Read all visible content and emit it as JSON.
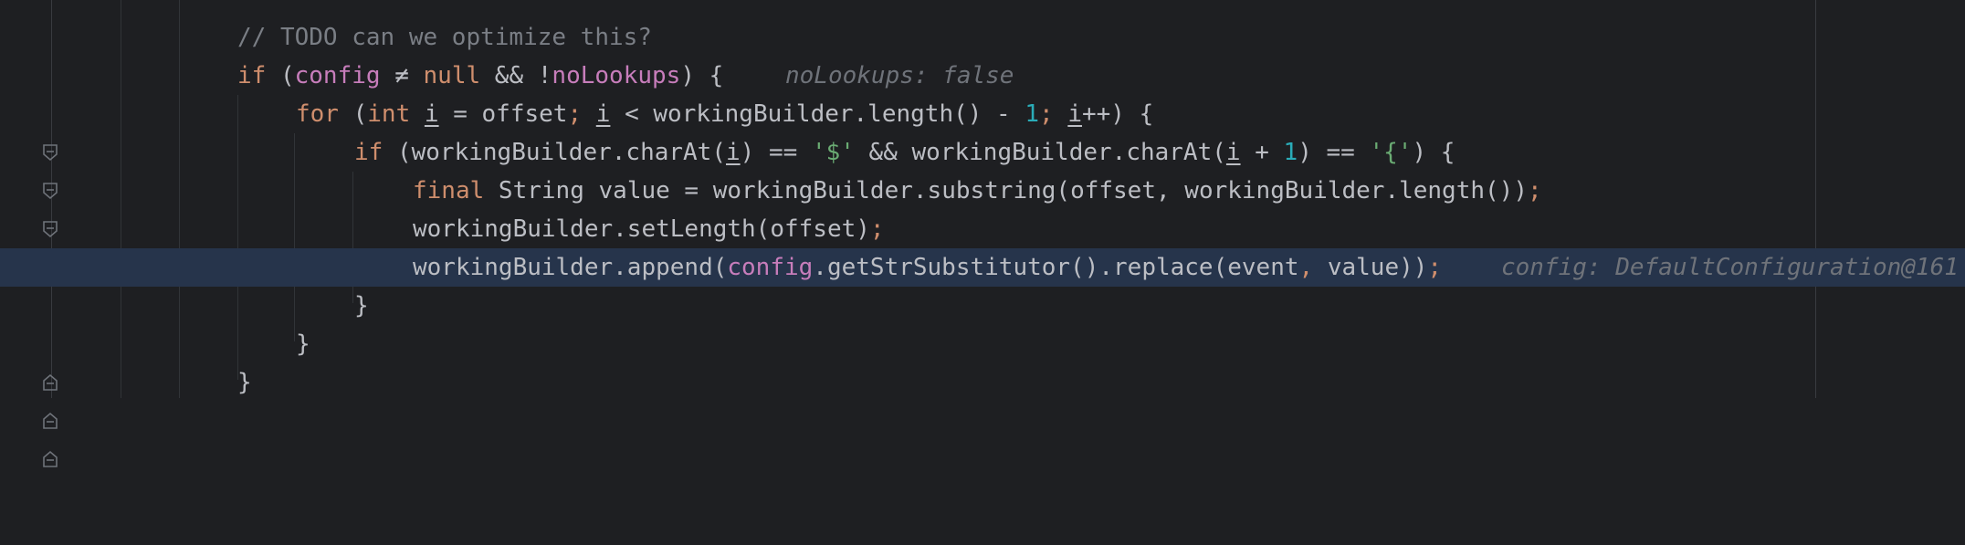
{
  "code": {
    "comment": "// TODO can we optimize this?",
    "l2": {
      "if_kw": "if",
      "open": " (",
      "config": "config",
      "neq": " ≠ ",
      "null_kw": "null",
      "and": " && !",
      "noLookups": "noLookups",
      "close": ") {",
      "hint": "noLookups: false"
    },
    "l3": {
      "for_kw": "for",
      "open": " (",
      "int_kw": "int",
      "sp": " ",
      "i1": "i",
      "assign": " = offset",
      "semi1": ";",
      "sp2": " ",
      "i2": "i",
      "cmp": " < workingBuilder.length() - ",
      "one": "1",
      "semi2": ";",
      "sp3": " ",
      "i3": "i",
      "inc": "++) {"
    },
    "l4": {
      "if_kw": "if",
      "open": " (workingBuilder.charAt(",
      "i1": "i",
      "eq1": ") == ",
      "str1": "'$'",
      "and": " && workingBuilder.charAt(",
      "i2": "i",
      "plus": " + ",
      "one": "1",
      "eq2": ") == ",
      "str2": "'{'",
      "close": ") {"
    },
    "l5": {
      "final_kw": "final",
      "rest": " String value = workingBuilder.substring(offset, workingBuilder.length())",
      "semi": ";"
    },
    "l6": {
      "text": "workingBuilder.setLength(offset)",
      "semi": ";"
    },
    "l7": {
      "pre": "workingBuilder.append(",
      "config": "config",
      "mid": ".getStrSubstitutor().replace(event",
      "comma": ",",
      "post": " value))",
      "semi": ";",
      "hint": "config: DefaultConfiguration@161"
    },
    "l8": "}",
    "l9": "}",
    "l10": "}"
  }
}
